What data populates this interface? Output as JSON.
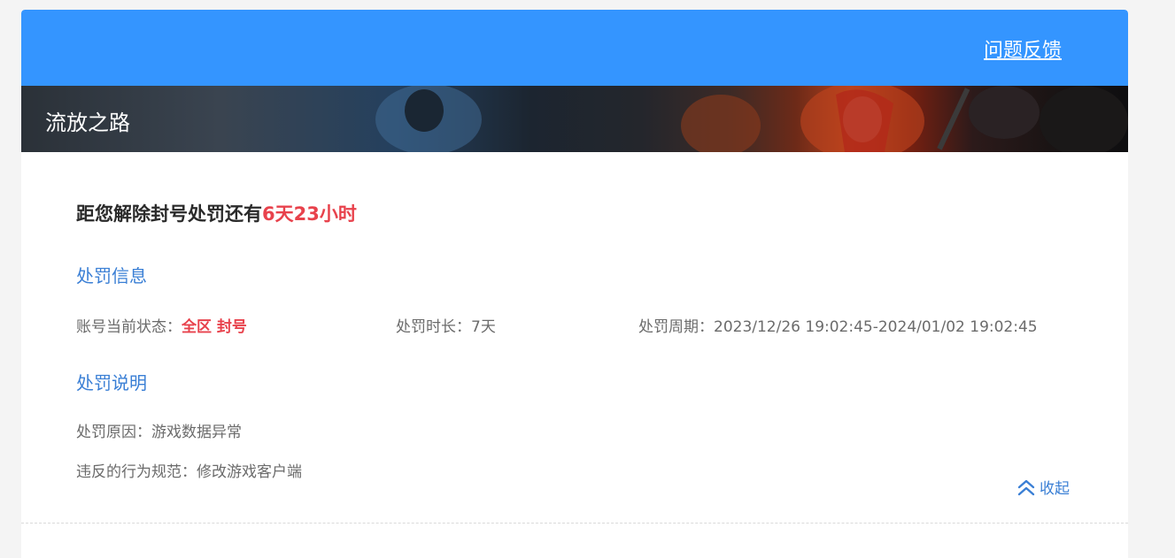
{
  "header": {
    "feedback_label": "问题反馈"
  },
  "banner": {
    "game_title": "流放之路"
  },
  "countdown": {
    "prefix": "距您解除封号处罚还有",
    "remaining": "6天23小时"
  },
  "penalty_info": {
    "section_title": "处罚信息",
    "status_label": "账号当前状态：",
    "status_value": "全区 封号",
    "duration_label": "处罚时长：",
    "duration_value": "7天",
    "period_label": "处罚周期：",
    "period_value": "2023/12/26 19:02:45-2024/01/02 19:02:45"
  },
  "penalty_desc": {
    "section_title": "处罚说明",
    "reason_label": "处罚原因：",
    "reason_value": "游戏数据异常",
    "violation_label": "违反的行为规范：",
    "violation_value": "修改游戏客户端"
  },
  "collapse": {
    "label": "收起"
  },
  "colors": {
    "header_blue": "#3495ff",
    "accent_red": "#e8424c",
    "link_blue": "#3a7fd5"
  }
}
